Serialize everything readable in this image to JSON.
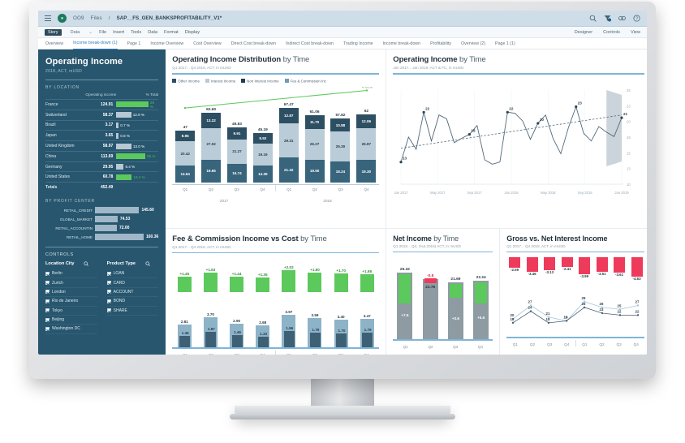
{
  "appbar": {
    "menu_icon": "hamburger-icon",
    "logo_icon": "app-logo-icon",
    "crumb1": "OO9",
    "crumb2": "Files",
    "separator": "/",
    "title": "SAP__FS_GEN_BANKSPROFITABILITY_V1*",
    "icons": [
      "search-icon",
      "filter-icon",
      "share-icon",
      "help-icon"
    ]
  },
  "menubar": {
    "story_chip": "Story",
    "data_chip": "Data",
    "caret": "chevron-down-icon",
    "items": [
      "File",
      "Insert",
      "Tools",
      "Data",
      "Format",
      "Display"
    ],
    "right_items": [
      "Designer",
      "Controls",
      "View"
    ]
  },
  "tabs": [
    {
      "label": "Overview",
      "active": false
    },
    {
      "label": "Income break-down (1)",
      "active": true
    },
    {
      "label": "Page 1",
      "active": false
    },
    {
      "label": "Income Overview",
      "active": false
    },
    {
      "label": "Cost Overview",
      "active": false
    },
    {
      "label": "Direct Cost break-down",
      "active": false
    },
    {
      "label": "Indirect Cost break-down",
      "active": false
    },
    {
      "label": "Trading Income",
      "active": false
    },
    {
      "label": "Income break-down",
      "active": false
    },
    {
      "label": "Profitability",
      "active": false
    },
    {
      "label": "Overview (2)",
      "active": false
    },
    {
      "label": "Page 1 (1)",
      "active": false
    }
  ],
  "sidebar": {
    "title": "Operating Income",
    "subtitle": "2018, ACT, mUSD",
    "by_location": {
      "section": "BY LOCATION",
      "col_name": "",
      "col_value": "Operating income",
      "col_pct": "% Total",
      "rows": [
        {
          "name": "France",
          "value": "124.91",
          "pct": "28 %",
          "pct_num": 28.0,
          "highlight": true
        },
        {
          "name": "Switzerland",
          "value": "58.37",
          "pct": "12.9 %",
          "pct_num": 12.9,
          "highlight": false
        },
        {
          "name": "Brazil",
          "value": "3.17",
          "pct": "0.7 %",
          "pct_num": 0.7,
          "highlight": false
        },
        {
          "name": "Japan",
          "value": "3.65",
          "pct": "0.8 %",
          "pct_num": 0.8,
          "highlight": false
        },
        {
          "name": "United Kingdom",
          "value": "58.97",
          "pct": "13.0 %",
          "pct_num": 13.0,
          "highlight": false
        },
        {
          "name": "China",
          "value": "113.69",
          "pct": "25 %",
          "pct_num": 25.0,
          "highlight": true
        },
        {
          "name": "Germany",
          "value": "29.95",
          "pct": "6.4 %",
          "pct_num": 6.4,
          "highlight": false
        },
        {
          "name": "United States",
          "value": "60.78",
          "pct": "13.4 %",
          "pct_num": 13.4,
          "highlight": true
        }
      ],
      "total_label": "Totals",
      "total_value": "452.49"
    },
    "by_profit_center": {
      "section": "BY PROFIT CENTER",
      "rows": [
        {
          "name": "RETAIL_CREDIT",
          "value": "145.60",
          "num": 145.6
        },
        {
          "name": "GLOBAL_MARKET",
          "value": "74.53",
          "num": 74.53
        },
        {
          "name": "RETAIL_ACCOUNTIN",
          "value": "72.00",
          "num": 72.0
        },
        {
          "name": "RETAIL_HOME",
          "value": "160.36",
          "num": 160.36
        }
      ]
    },
    "controls": {
      "section": "CONTROLS",
      "groups": [
        {
          "title": "Location City",
          "search_icon": "search-icon",
          "items": [
            "Berlin",
            "Zurich",
            "London",
            "Rio de Janeiro",
            "Tokyo",
            "Beijing",
            "Washington DC"
          ]
        },
        {
          "title": "Product Type",
          "search_icon": "search-icon",
          "items": [
            "LOAN",
            "CARD",
            "ACCOUNT",
            "BOND",
            "SHARE"
          ]
        }
      ]
    }
  },
  "colors": {
    "sidebar_bg": "#28566e",
    "accent_blue": "#7fb4d8",
    "green": "#5cc95c",
    "red": "#ef3b5b",
    "dark_navy": "#2d4f63",
    "light_steel": "#b9ccd8",
    "grey_bar": "#8e9ba3"
  },
  "chart_data": [
    {
      "id": "operating-income-distribution",
      "type": "bar",
      "title": "Operating Income Distribution",
      "title_suffix": "by Time",
      "subtitle": "Q1 2017... Q4 2018, ACT, in mUSD",
      "legend": [
        {
          "label": "Other Income",
          "color": "#2d4f63"
        },
        {
          "label": "Interest Income",
          "color": "#b9ccd8"
        },
        {
          "label": "Non Interest Income",
          "color": "#1f3d4e"
        },
        {
          "label": "Fee & Commission Inc",
          "color": "#6f9cb8"
        }
      ],
      "categories": [
        "Q1",
        "Q2",
        "Q3",
        "Q4",
        "Q1",
        "Q2",
        "Q3",
        "Q4"
      ],
      "year_groups": [
        "2017",
        "2018"
      ],
      "totals": [
        "47",
        "62.60",
        "49.83",
        "45.19",
        "67.47",
        "61.06",
        "57.82",
        "62"
      ],
      "totals_num": [
        47,
        62.6,
        49.83,
        45.19,
        67.47,
        61.06,
        57.82,
        62
      ],
      "series": [
        {
          "name": "top",
          "values": [
            8.95,
            13.22,
            9.91,
            8.92,
            12.87,
            11.7,
            10.88,
            12.06
          ],
          "labels": [
            "8.95",
            "13.22",
            "9.91",
            "8.92",
            "12.87",
            "11.70",
            "10.88",
            "12.06"
          ]
        },
        {
          "name": "middle",
          "values": [
            20.42,
            27.02,
            21.27,
            19.19,
            29.31,
            26.27,
            25.3,
            26.87
          ],
          "labels": [
            "20.42",
            "27.02",
            "21.27",
            "19.19",
            "29.31",
            "26.27",
            "25.30",
            "26.87"
          ]
        },
        {
          "name": "bottom",
          "values": [
            14.64,
            19.65,
            15.74,
            14.39,
            21.32,
            19.5,
            18.24,
            19.3
          ],
          "labels": [
            "14.64",
            "19.65",
            "15.74",
            "14.39",
            "21.32",
            "19.50",
            "18.24",
            "19.30"
          ]
        }
      ],
      "trend_label": "4.02%",
      "ylim": [
        0,
        72
      ]
    },
    {
      "id": "operating-income-by-time",
      "type": "line",
      "title": "Operating Income",
      "title_suffix": "by Time",
      "subtitle": "Jan 2017... Jan 2019, ACT & FC, in mUSD",
      "xlabel": "",
      "ylabel": "",
      "x_ticks": [
        "Jan 2017",
        "May 2017",
        "Sep 2017",
        "Jan 2018",
        "May 2018",
        "Sep 2018",
        "Jan 2019"
      ],
      "y_ticks": [
        "10",
        "13",
        "15",
        "18",
        "20",
        "23",
        "25"
      ],
      "ylim": [
        9,
        26
      ],
      "annotations": [
        "13",
        "22",
        "18",
        "22",
        "20",
        "23",
        "21"
      ],
      "values": [
        13,
        17.5,
        15.3,
        22,
        16.8,
        21.5,
        20.8,
        16.5,
        17.3,
        18,
        19.6,
        13.4,
        12.6,
        13.0,
        22,
        21.8,
        20.4,
        17.1,
        20,
        21.5,
        17.2,
        14.5,
        19.2,
        23,
        18.2,
        16.8,
        19.4,
        18.4,
        17.6,
        21
      ],
      "forecast_band": true,
      "trend_line": true
    },
    {
      "id": "fee-commission-income-vs-cost",
      "type": "bar",
      "title": "Fee & Commission Income vs Cost",
      "title_suffix": "by Time",
      "subtitle": "Q1 2017... Q4 2018, ACT, in mUSD",
      "categories": [
        "Q1",
        "Q2",
        "Q3",
        "Q4",
        "Q1",
        "Q2",
        "Q3",
        "Q4"
      ],
      "delta_labels": [
        "+1.45",
        "+1.83",
        "+1.44",
        "+1.35",
        "+2.02",
        "+1.80",
        "+1.70",
        "+1.68"
      ],
      "delta_values": [
        1.45,
        1.83,
        1.44,
        1.35,
        2.02,
        1.8,
        1.7,
        1.68
      ],
      "series": [
        {
          "name": "Income",
          "values": [
            2.81,
            3.7,
            2.9,
            2.68,
            3.97,
            3.59,
            3.4,
            3.47
          ],
          "labels": [
            "2.81",
            "3.70",
            "2.90",
            "2.68",
            "3.97",
            "3.59",
            "3.40",
            "3.47"
          ]
        },
        {
          "name": "Cost",
          "values": [
            1.36,
            1.87,
            1.46,
            1.33,
            1.96,
            1.79,
            1.7,
            1.79
          ],
          "labels": [
            "1.36",
            "1.87",
            "1.46",
            "1.33",
            "1.96",
            "1.79",
            "1.70",
            "1.79"
          ]
        }
      ]
    },
    {
      "id": "net-income-by-time",
      "type": "bar",
      "title": "Net Income",
      "title_suffix": "by Time",
      "subtitle": "Q1 2018... Q4, (%Δ 2018) ACT, in mUSD",
      "categories": [
        "Q1",
        "Q2",
        "Q3",
        "Q4"
      ],
      "values": [
        25.32,
        22.76,
        21.69,
        22.24
      ],
      "value_labels": [
        "25.32",
        "-0.8",
        "21.69",
        "22.24"
      ],
      "inner_labels": [
        "",
        "22.76",
        "",
        ""
      ],
      "delta_labels": [
        "+7.5",
        "-0.8",
        "+3.6",
        "+5.5"
      ],
      "delta_values": [
        7.5,
        -0.8,
        3.6,
        5.5
      ],
      "delta_colors": [
        "#5cc95c",
        "#ef3b5b",
        "#5cc95c",
        "#5cc95c"
      ]
    },
    {
      "id": "gross-vs-net-interest-income",
      "type": "bar",
      "title": "Gross vs. Net Interest Income",
      "title_suffix": "",
      "subtitle": "Q1 2017... Q4 2018, ACT, in mUSD",
      "categories": [
        "Q1",
        "Q2",
        "Q3",
        "Q4",
        "Q1",
        "Q2",
        "Q3",
        "Q4"
      ],
      "deviation_labels": [
        "-2.59",
        "-3.46",
        "-3.13",
        "-2.41",
        "-3.99",
        "-3.51",
        "-3.61",
        "-4.63"
      ],
      "deviation_values": [
        -2.59,
        -3.46,
        -3.13,
        -2.41,
        -3.99,
        -3.51,
        -3.61,
        -4.63
      ],
      "series": [
        {
          "name": "Gross",
          "values": [
            20,
            27,
            21,
            19,
            29,
            26,
            25,
            27
          ],
          "labels": [
            "20",
            "27",
            "21",
            "19",
            "29",
            "26",
            "25",
            "27"
          ],
          "color": "#a8c6db"
        },
        {
          "name": "Net",
          "values": [
            18,
            24,
            18,
            19,
            26,
            23,
            22,
            22
          ],
          "labels": [
            "18",
            "24",
            "18",
            "19",
            "26",
            "23",
            "22",
            "22"
          ],
          "color": "#4a6275"
        }
      ]
    }
  ]
}
